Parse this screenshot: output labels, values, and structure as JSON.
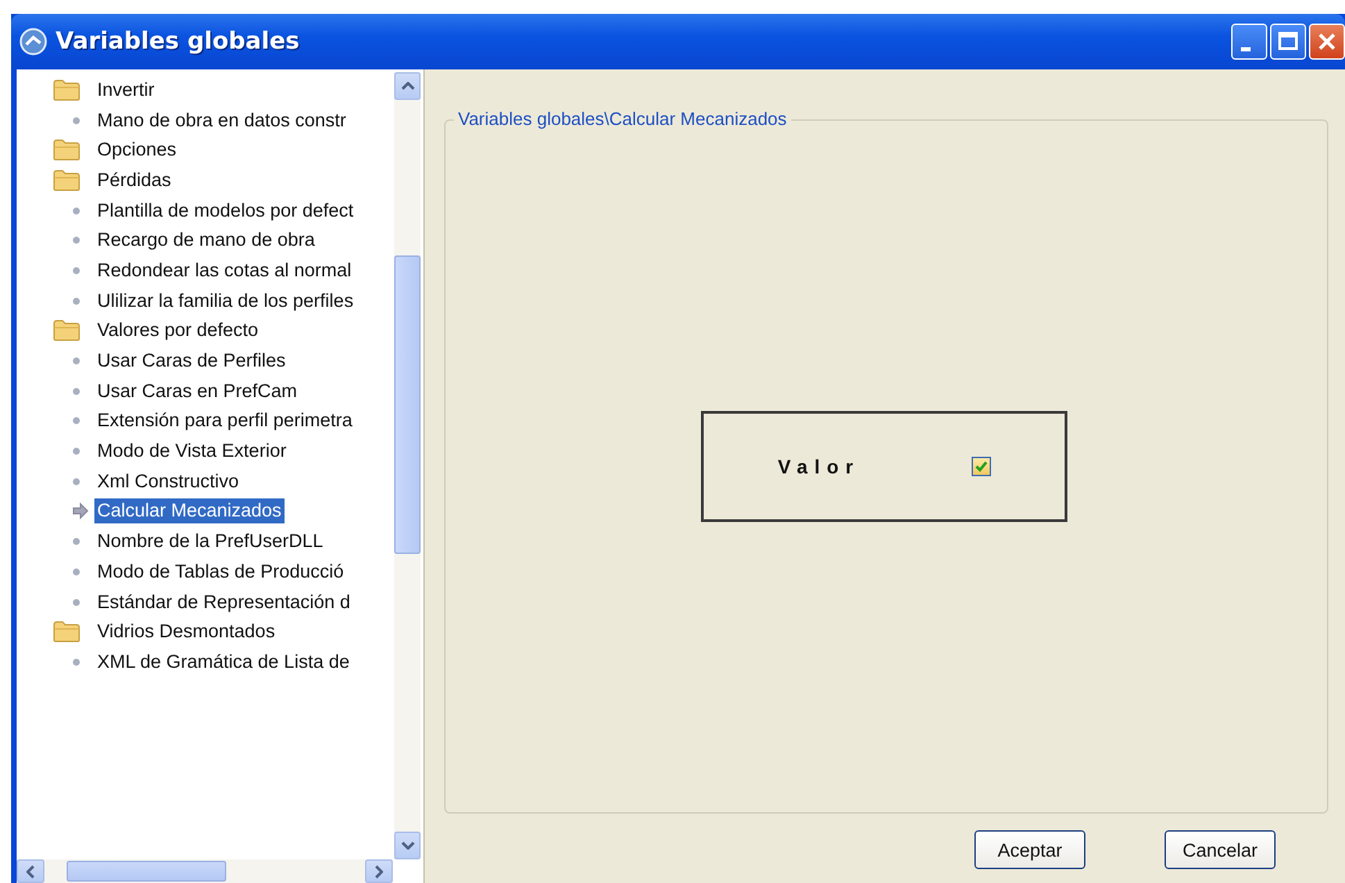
{
  "window": {
    "title": "Variables globales"
  },
  "tree": [
    {
      "kind": "folder",
      "label": "Invertir",
      "selected": false,
      "children": [
        {
          "kind": "leaf",
          "label": "Mano de obra en datos constr",
          "selected": false
        }
      ]
    },
    {
      "kind": "folder",
      "label": "Opciones",
      "selected": false
    },
    {
      "kind": "folder",
      "label": "Pérdidas",
      "selected": false,
      "children": [
        {
          "kind": "leaf",
          "label": "Plantilla de modelos por defect",
          "selected": false
        },
        {
          "kind": "leaf",
          "label": "Recargo de mano de obra",
          "selected": false
        },
        {
          "kind": "leaf",
          "label": "Redondear las cotas al normal",
          "selected": false
        },
        {
          "kind": "leaf",
          "label": "Ulilizar la familia de los perfiles",
          "selected": false
        }
      ]
    },
    {
      "kind": "folder",
      "label": "Valores por defecto",
      "selected": false,
      "children": [
        {
          "kind": "leaf",
          "label": "Usar Caras de Perfiles",
          "selected": false
        },
        {
          "kind": "leaf",
          "label": "Usar Caras en PrefCam",
          "selected": false
        },
        {
          "kind": "leaf",
          "label": "Extensión para perfil perimetra",
          "selected": false
        },
        {
          "kind": "leaf",
          "label": "Modo de Vista Exterior",
          "selected": false
        },
        {
          "kind": "leaf",
          "label": "Xml Constructivo",
          "selected": false
        },
        {
          "kind": "leaf",
          "label": "Calcular Mecanizados",
          "selected": true
        },
        {
          "kind": "leaf",
          "label": "Nombre de la PrefUserDLL",
          "selected": false
        },
        {
          "kind": "leaf",
          "label": "Modo de Tablas de Producció",
          "selected": false
        },
        {
          "kind": "leaf",
          "label": "Estándar de Representación d",
          "selected": false
        }
      ]
    },
    {
      "kind": "folder",
      "label": "Vidrios Desmontados",
      "selected": false,
      "children": [
        {
          "kind": "leaf",
          "label": "XML de Gramática de Lista de",
          "selected": false
        }
      ]
    }
  ],
  "group": {
    "title": "Variables globales\\Calcular Mecanizados",
    "field": {
      "label": "Valor",
      "checked": true
    }
  },
  "buttons": [
    "Aceptar",
    "Cancelar"
  ]
}
